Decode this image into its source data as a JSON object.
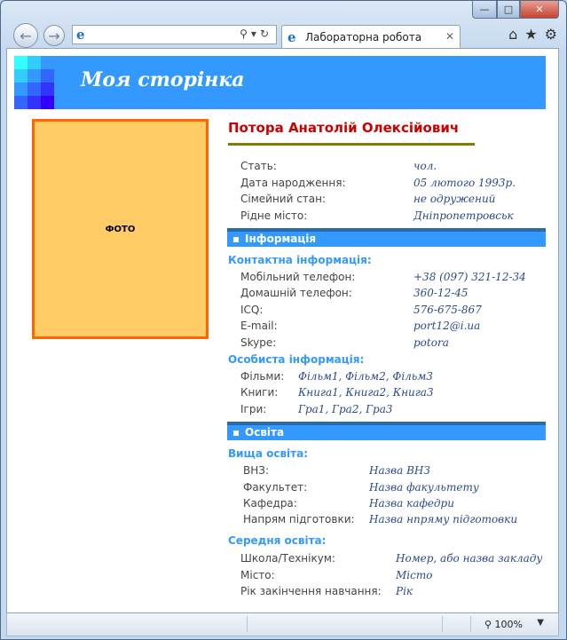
{
  "browser": {
    "tab_title": "Лабораторна робота",
    "zoom": "100%",
    "window_controls": {
      "minimize": "—",
      "maximize": "□",
      "close": "✕"
    }
  },
  "page": {
    "title": "Моя сторінка",
    "photo_label": "ФОТО",
    "name": "Потора Анатолій Олексійович",
    "personal": [
      {
        "label": "Стать:",
        "value": "чол."
      },
      {
        "label": "Дата народження:",
        "value": "05 лютого 1993р."
      },
      {
        "label": "Сімейний стан:",
        "value": "не одружений"
      },
      {
        "label": "Рідне місто:",
        "value": "Дніпропетровськ"
      }
    ],
    "info_header": "Інформація",
    "contact_title": "Контактна інформація:",
    "contact": [
      {
        "label": "Мобільний телефон:",
        "value": "+38 (097) 321-12-34"
      },
      {
        "label": "Домашній телефон:",
        "value": "360-12-45"
      },
      {
        "label": "ICQ:",
        "value": "576-675-867"
      },
      {
        "label": "E-mail:",
        "value": "port12@i.ua"
      },
      {
        "label": "Skype:",
        "value": "potora"
      }
    ],
    "personal_info_title": "Особиста інформація:",
    "interests": [
      {
        "label": "Фільми:",
        "value": "Фільм1, Фільм2, Фільм3"
      },
      {
        "label": "Книги:",
        "value": "Книга1, Книга2, Книга3"
      },
      {
        "label": "Ігри:",
        "value": "Гра1, Гра2, Гра3"
      }
    ],
    "education_header": "Освіта",
    "higher_title": "Вища освіта:",
    "higher": [
      {
        "label": "ВНЗ:",
        "value": "Назва ВНЗ"
      },
      {
        "label": "Факультет:",
        "value": "Назва факультету"
      },
      {
        "label": "Кафедра:",
        "value": "Назва кафедри"
      },
      {
        "label": "Напрям підготовки:",
        "value": "Назва нпряму підготовки"
      }
    ],
    "secondary_title": "Середня освіта:",
    "secondary": [
      {
        "label": "Школа/Технікум:",
        "value": "Номер, або назва закладу"
      },
      {
        "label": "Місто:",
        "value": "Місто"
      },
      {
        "label": "Рік закінчення навчання:",
        "value": "Рік"
      }
    ]
  },
  "colors": {
    "header_blue": "#3399ff",
    "photo_fill": "#ffcc66",
    "photo_border": "#ff6600",
    "name_red": "#cc0000",
    "name_underline": "#808000"
  },
  "icons": [
    "back-icon",
    "forward-icon",
    "ie-icon",
    "search-icon",
    "refresh-icon",
    "home-icon",
    "favorites-star-icon",
    "tools-gear-icon",
    "zoom-icon"
  ]
}
